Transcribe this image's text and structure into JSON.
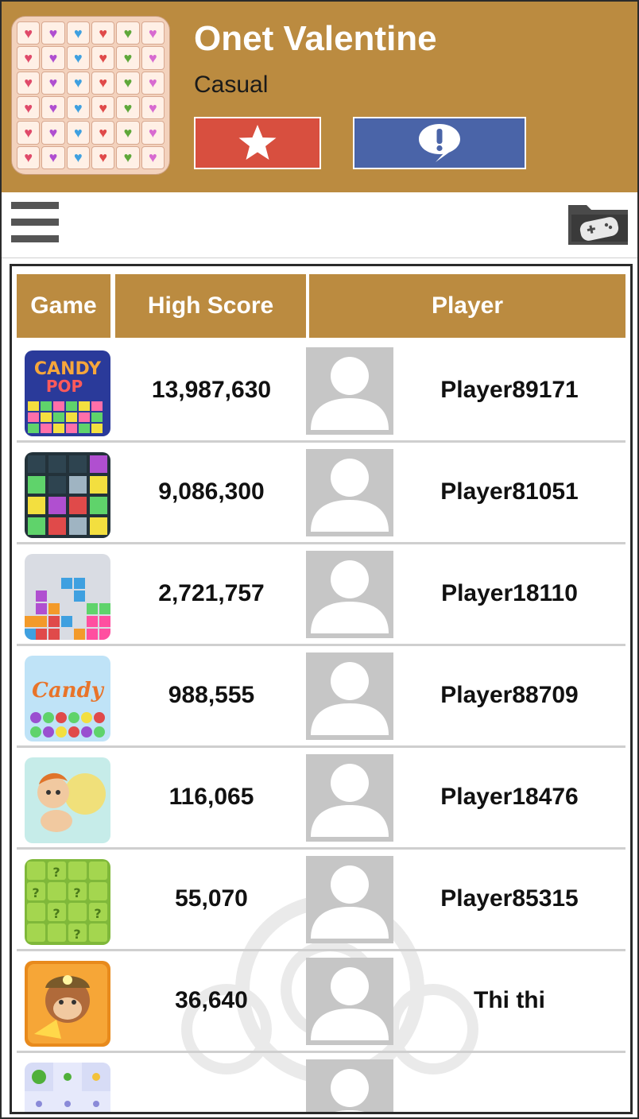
{
  "app": {
    "title": "Onet Valentine",
    "category": "Casual"
  },
  "app_icon_tiles": [
    "♥",
    "♥",
    "♥",
    "♥",
    "♥",
    "♥",
    "♥",
    "♥",
    "♥",
    "♥",
    "♥",
    "♥",
    "♥",
    "♥",
    "♥",
    "♥",
    "♥",
    "♥",
    "♥",
    "♥",
    "♥",
    "♥",
    "♥",
    "♥",
    "♥",
    "♥",
    "♥",
    "♥",
    "♥",
    "♥",
    "♥",
    "♥",
    "♥",
    "♥",
    "♥",
    "♥"
  ],
  "icons": {
    "favorite": "star-icon",
    "report": "exclamation-bubble-icon",
    "menu": "hamburger-icon",
    "games": "game-folder-icon"
  },
  "colors": {
    "header": "#bb8b40",
    "favorite_button": "#d84f3f",
    "report_button": "#4a64a8",
    "avatar_placeholder": "#c6c6c6"
  },
  "table": {
    "headers": {
      "game": "Game",
      "score": "High Score",
      "player": "Player"
    },
    "rows": [
      {
        "score": "13,987,630",
        "player": "Player89171"
      },
      {
        "score": "9,086,300",
        "player": "Player81051"
      },
      {
        "score": "2,721,757",
        "player": "Player18110"
      },
      {
        "score": "988,555",
        "player": "Player88709"
      },
      {
        "score": "116,065",
        "player": "Player18476"
      },
      {
        "score": "55,070",
        "player": "Player85315"
      },
      {
        "score": "36,640",
        "player": "Thi thi"
      },
      {
        "score": "",
        "player": ""
      }
    ]
  }
}
